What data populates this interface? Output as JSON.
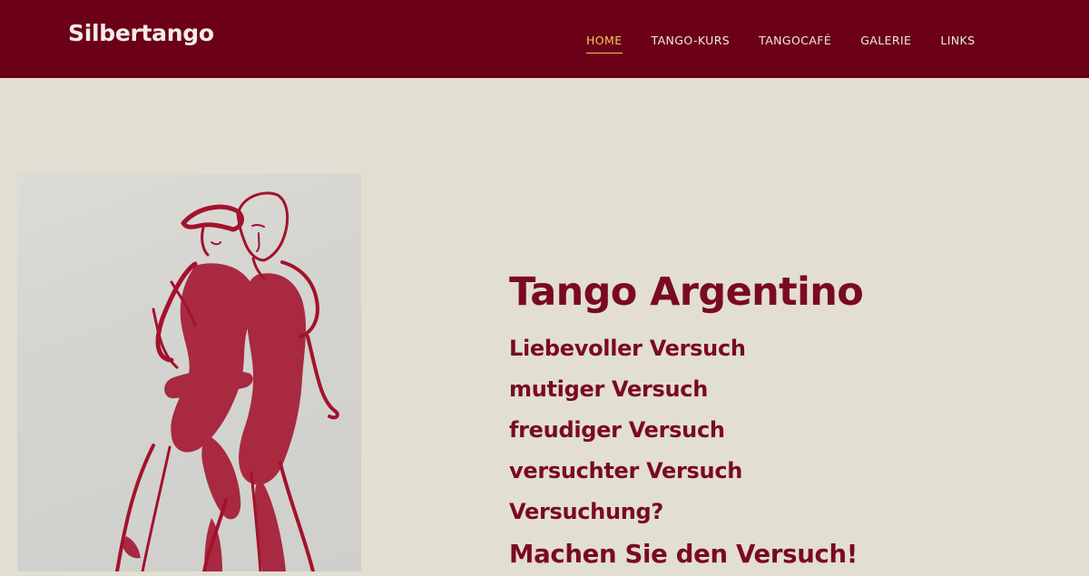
{
  "header": {
    "logo": "Silbertango",
    "nav": [
      {
        "label": "HOME",
        "active": true
      },
      {
        "label": "TANGO-KURS",
        "active": false
      },
      {
        "label": "TANGOCAFÉ",
        "active": false
      },
      {
        "label": "GALERIE",
        "active": false
      },
      {
        "label": "LINKS",
        "active": false
      }
    ]
  },
  "main": {
    "title": "Tango Argentino",
    "lines": [
      "Liebevoller Versuch",
      "mutiger Versuch",
      "freudiger Versuch",
      "versuchter Versuch",
      "Versuchung?"
    ],
    "cta": "Machen Sie den Versuch!"
  },
  "colors": {
    "header_bg": "#6b0016",
    "page_bg": "#e2ded2",
    "accent": "#f2c66a",
    "text": "#7a0a1f",
    "paint": "#a3122d"
  },
  "image": {
    "subject": "painting-tango-couple"
  }
}
